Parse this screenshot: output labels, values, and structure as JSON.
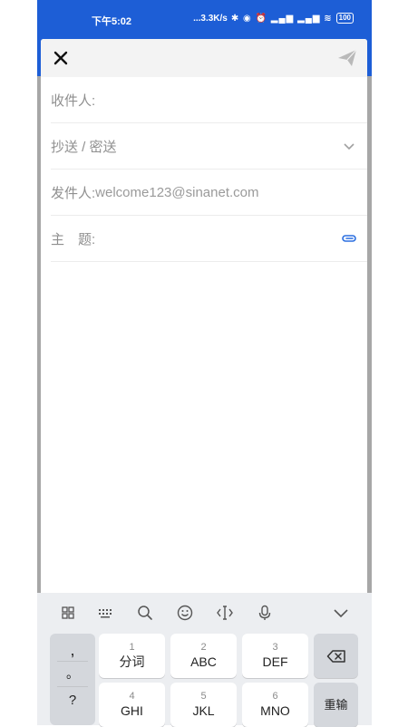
{
  "status_bar": {
    "time": "下午5:02",
    "speed": "...3.3K/s",
    "battery": "100"
  },
  "header": {
    "close_icon": "close-icon",
    "send_icon": "send-paper-plane-icon"
  },
  "form": {
    "to_label": "收件人:",
    "cc_label": "抄送 / 密送",
    "from_label": "发件人:",
    "from_value": "welcome123@sinanet.com",
    "subject_label": "主　题:",
    "attach_icon": "paperclip-icon"
  },
  "keyboard": {
    "toolbar": [
      "grid-menu-icon",
      "keyboard-icon",
      "search-icon",
      "emoji-icon",
      "cursor-icon",
      "microphone-icon",
      "chevron-down-icon"
    ],
    "punct": [
      ",",
      "。",
      "?"
    ],
    "keys": [
      {
        "num": "1",
        "letters": "分词"
      },
      {
        "num": "2",
        "letters": "ABC"
      },
      {
        "num": "3",
        "letters": "DEF"
      },
      {
        "num": "4",
        "letters": "GHI"
      },
      {
        "num": "5",
        "letters": "JKL"
      },
      {
        "num": "6",
        "letters": "MNO"
      }
    ],
    "delete_icon": "backspace-icon",
    "reenter_label": "重输"
  },
  "colors": {
    "brand_blue": "#1d5ed6",
    "attach_blue": "#2b6fe0"
  }
}
